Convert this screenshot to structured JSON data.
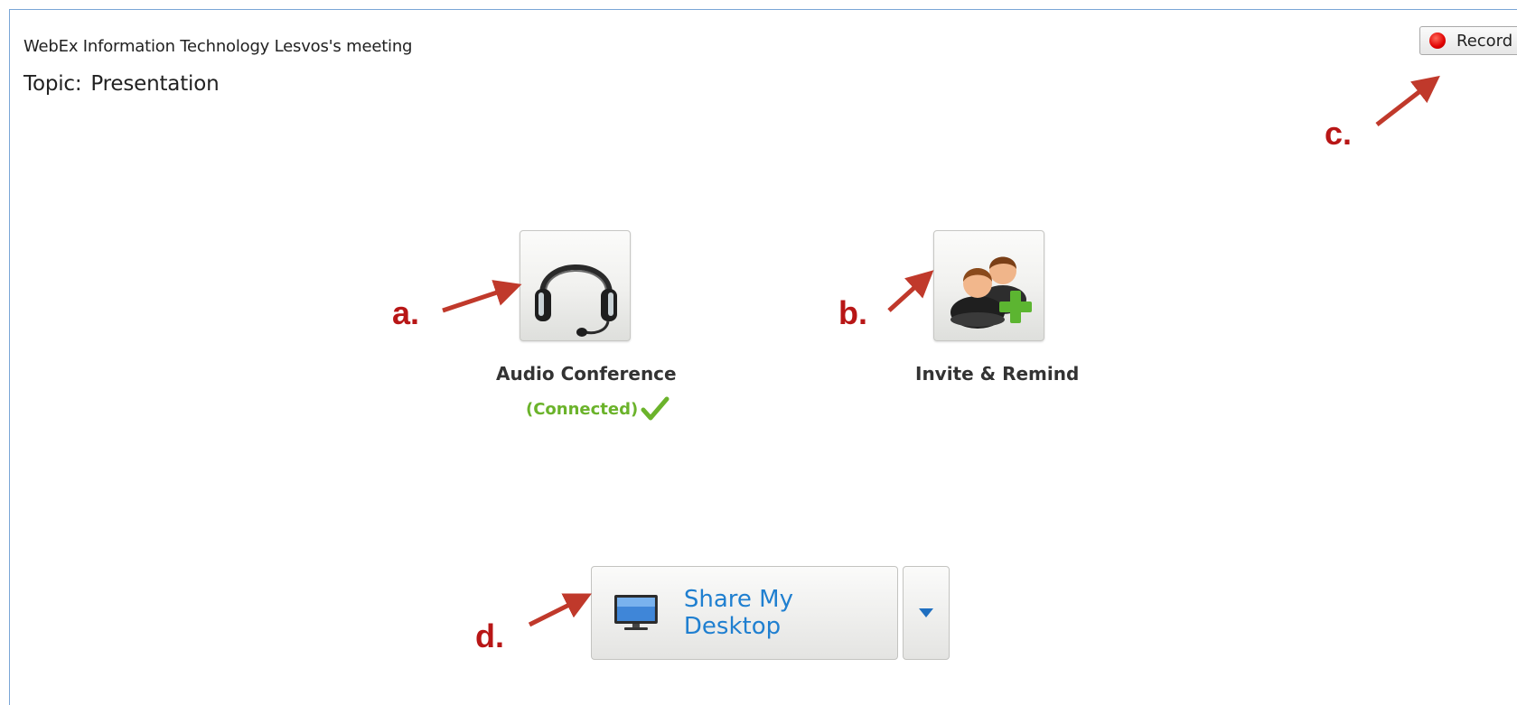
{
  "meeting": {
    "title": "WebEx Information Technology Lesvos's meeting",
    "topic_label": "Topic:",
    "topic_value": "Presentation"
  },
  "toolbar": {
    "record_label": "Record"
  },
  "actions": {
    "audio": {
      "label": "Audio Conference",
      "status": "(Connected)",
      "icon": "headset-icon"
    },
    "invite": {
      "label": "Invite & Remind",
      "icon": "add-people-icon"
    }
  },
  "share": {
    "label": "Share My Desktop",
    "icon": "monitor-icon"
  },
  "annotations": {
    "a": "a.",
    "b": "b.",
    "c": "c.",
    "d": "d."
  },
  "colors": {
    "annotation": "#b81616",
    "arrow": "#c0392b",
    "connected": "#6bb32b",
    "share_text": "#1f7fd0",
    "record_dot": "#e00000"
  }
}
